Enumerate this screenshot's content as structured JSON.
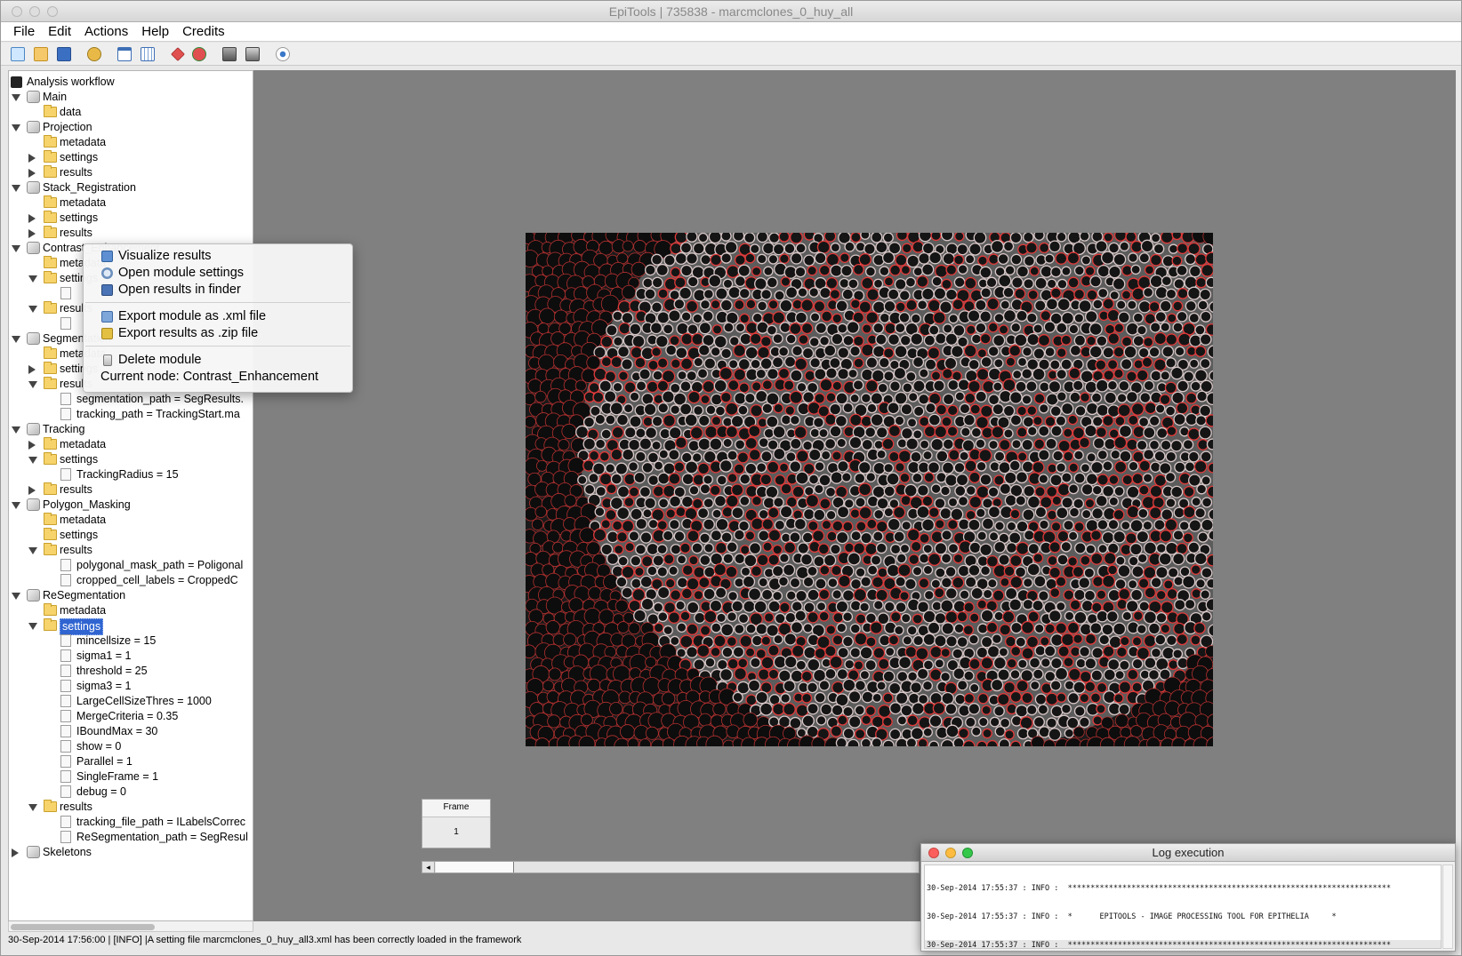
{
  "window": {
    "title": "EpiTools | 735838 - marcmclones_0_huy_all"
  },
  "menu": {
    "file": "File",
    "edit": "Edit",
    "actions": "Actions",
    "help": "Help",
    "credits": "Credits"
  },
  "toolbar_icons": [
    "new-file-icon",
    "open-folder-icon",
    "save-icon",
    "add-module-icon",
    "window-icon",
    "table-icon",
    "remove-icon",
    "add-check-icon",
    "server-icon",
    "export-icon",
    "eye-icon"
  ],
  "tree": {
    "root": "Analysis workflow",
    "rows": [
      {
        "label": "Main",
        "kind": "module",
        "level": 1,
        "expand": "open"
      },
      {
        "label": "data",
        "kind": "folder",
        "level": 2,
        "expand": "none"
      },
      {
        "label": "Projection",
        "kind": "module",
        "level": 1,
        "expand": "open"
      },
      {
        "label": "metadata",
        "kind": "folder",
        "level": 2,
        "expand": "none"
      },
      {
        "label": "settings",
        "kind": "folder",
        "level": 2,
        "expand": "closed"
      },
      {
        "label": "results",
        "kind": "folder",
        "level": 2,
        "expand": "closed"
      },
      {
        "label": "Stack_Registration",
        "kind": "module",
        "level": 1,
        "expand": "open"
      },
      {
        "label": "metadata",
        "kind": "folder",
        "level": 2,
        "expand": "none"
      },
      {
        "label": "settings",
        "kind": "folder",
        "level": 2,
        "expand": "closed"
      },
      {
        "label": "results",
        "kind": "folder",
        "level": 2,
        "expand": "closed"
      },
      {
        "label": "Contrast_Enhancement",
        "kind": "module",
        "level": 1,
        "expand": "open"
      },
      {
        "label": "metadata",
        "kind": "folder",
        "level": 2,
        "expand": "none"
      },
      {
        "label": "settings",
        "kind": "folder",
        "level": 2,
        "expand": "open"
      },
      {
        "label": "",
        "kind": "leaf",
        "level": 3,
        "expand": "none"
      },
      {
        "label": "results",
        "kind": "folder",
        "level": 2,
        "expand": "open"
      },
      {
        "label": "",
        "kind": "leaf",
        "level": 3,
        "expand": "none"
      },
      {
        "label": "Segmentation",
        "kind": "module",
        "level": 1,
        "expand": "open"
      },
      {
        "label": "metadata",
        "kind": "folder",
        "level": 2,
        "expand": "none"
      },
      {
        "label": "settings",
        "kind": "folder",
        "level": 2,
        "expand": "closed"
      },
      {
        "label": "results",
        "kind": "folder",
        "level": 2,
        "expand": "open"
      },
      {
        "label": "segmentation_path = SegResults.",
        "kind": "leaf",
        "level": 3,
        "expand": "none"
      },
      {
        "label": "tracking_path = TrackingStart.ma",
        "kind": "leaf",
        "level": 3,
        "expand": "none"
      },
      {
        "label": "Tracking",
        "kind": "module",
        "level": 1,
        "expand": "open"
      },
      {
        "label": "metadata",
        "kind": "folder",
        "level": 2,
        "expand": "closed"
      },
      {
        "label": "settings",
        "kind": "folder",
        "level": 2,
        "expand": "open"
      },
      {
        "label": "TrackingRadius = 15",
        "kind": "leaf",
        "level": 3,
        "expand": "none"
      },
      {
        "label": "results",
        "kind": "folder",
        "level": 2,
        "expand": "closed"
      },
      {
        "label": "Polygon_Masking",
        "kind": "module",
        "level": 1,
        "expand": "open"
      },
      {
        "label": "metadata",
        "kind": "folder",
        "level": 2,
        "expand": "none"
      },
      {
        "label": "settings",
        "kind": "folder",
        "level": 2,
        "expand": "none"
      },
      {
        "label": "results",
        "kind": "folder",
        "level": 2,
        "expand": "open"
      },
      {
        "label": "polygonal_mask_path = Poligonal",
        "kind": "leaf",
        "level": 3,
        "expand": "none"
      },
      {
        "label": "cropped_cell_labels = CroppedC",
        "kind": "leaf",
        "level": 3,
        "expand": "none"
      },
      {
        "label": "ReSegmentation",
        "kind": "module",
        "level": 1,
        "expand": "open"
      },
      {
        "label": "metadata",
        "kind": "folder",
        "level": 2,
        "expand": "none"
      },
      {
        "label": "settings",
        "kind": "folder",
        "level": 2,
        "expand": "open",
        "selected": true
      },
      {
        "label": "mincellsize = 15",
        "kind": "leaf",
        "level": 3,
        "expand": "none"
      },
      {
        "label": "sigma1 = 1",
        "kind": "leaf",
        "level": 3,
        "expand": "none"
      },
      {
        "label": "threshold = 25",
        "kind": "leaf",
        "level": 3,
        "expand": "none"
      },
      {
        "label": "sigma3 = 1",
        "kind": "leaf",
        "level": 3,
        "expand": "none"
      },
      {
        "label": "LargeCellSizeThres = 1000",
        "kind": "leaf",
        "level": 3,
        "expand": "none"
      },
      {
        "label": "MergeCriteria = 0.35",
        "kind": "leaf",
        "level": 3,
        "expand": "none"
      },
      {
        "label": "IBoundMax = 30",
        "kind": "leaf",
        "level": 3,
        "expand": "none"
      },
      {
        "label": "show = 0",
        "kind": "leaf",
        "level": 3,
        "expand": "none"
      },
      {
        "label": "Parallel = 1",
        "kind": "leaf",
        "level": 3,
        "expand": "none"
      },
      {
        "label": "SingleFrame = 1",
        "kind": "leaf",
        "level": 3,
        "expand": "none"
      },
      {
        "label": "debug = 0",
        "kind": "leaf",
        "level": 3,
        "expand": "none"
      },
      {
        "label": "results",
        "kind": "folder",
        "level": 2,
        "expand": "open"
      },
      {
        "label": "tracking_file_path = ILabelsCorrec",
        "kind": "leaf",
        "level": 3,
        "expand": "none"
      },
      {
        "label": "ReSegmentation_path = SegResul",
        "kind": "leaf",
        "level": 3,
        "expand": "none"
      },
      {
        "label": "Skeletons",
        "kind": "module",
        "level": 1,
        "expand": "closed"
      }
    ]
  },
  "context_menu": {
    "visualize": "Visualize results",
    "open_settings": "Open module settings",
    "open_finder": "Open results in finder",
    "export_xml": "Export module as .xml file",
    "export_zip": "Export results as .zip file",
    "delete": "Delete module",
    "current_node": "Current node: Contrast_Enhancement"
  },
  "viewer": {
    "frame_label": "Frame",
    "frame_value": "1"
  },
  "status": "30-Sep-2014 17:56:00 | [INFO] |A setting file marcmclones_0_huy_all3.xml has been correctly loaded in the framework",
  "log": {
    "title": "Log execution",
    "lines": [
      "30-Sep-2014 17:55:37 : INFO :  ***********************************************************************",
      "30-Sep-2014 17:55:37 : INFO :  *      EPITOOLS - IMAGE PROCESSING TOOL FOR EPITHELIA     *",
      "30-Sep-2014 17:55:37 : INFO :  ***********************************************************************"
    ]
  },
  "colors": {
    "selection": "#2f64d1",
    "background": "#808080",
    "segmentation_lines": "#e23a3a",
    "close_dot": "#fc605c",
    "min_dot": "#fdbc40",
    "max_dot": "#34c84a"
  }
}
